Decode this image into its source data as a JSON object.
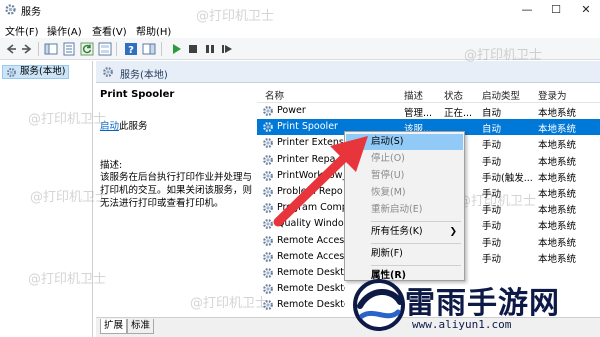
{
  "window": {
    "title": "服务"
  },
  "menu": [
    "文件(F)",
    "操作(A)",
    "查看(V)",
    "帮助(H)"
  ],
  "tree": {
    "node": "服务(本地)"
  },
  "header": {
    "title": "服务(本地)"
  },
  "description": {
    "service_name": "Print Spooler",
    "start_link": "启动",
    "start_suffix": "此服务",
    "desc_label": "描述:",
    "desc_text": "该服务在后台执行打印作业并处理与打印机的交互。如果关闭该服务，则无法进行打印或查看打印机。"
  },
  "columns": {
    "name": "名称",
    "desc": "描述",
    "status": "状态",
    "startup": "启动类型",
    "logon": "登录为"
  },
  "services": [
    {
      "name": "Power",
      "desc": "管理...",
      "status": "正在...",
      "startup": "自动",
      "logon": "本地系统"
    },
    {
      "name": "Print Spooler",
      "desc": "该服...",
      "status": "",
      "startup": "自动",
      "logon": "本地系统",
      "selected": true
    },
    {
      "name": "Printer Extensio",
      "desc": "",
      "status": "",
      "startup": "手动",
      "logon": "本地系统"
    },
    {
      "name": "Printer Repa",
      "desc": "",
      "status": "",
      "startup": "手动",
      "logon": "本地系统"
    },
    {
      "name": "PrintWorkflow_",
      "desc": "",
      "status": "",
      "startup": "手动(触发...",
      "logon": "本地系统"
    },
    {
      "name": "Problem Repo",
      "desc": "",
      "status": "",
      "startup": "手动",
      "logon": "本地系统"
    },
    {
      "name": "Program Comp",
      "desc": "",
      "status": "",
      "startup": "手动",
      "logon": "本地系统"
    },
    {
      "name": "Quality Window",
      "desc": "",
      "status": "",
      "startup": "手动",
      "logon": "本地系统"
    },
    {
      "name": "Remote Access",
      "desc": "",
      "status": "",
      "startup": "手动",
      "logon": "本地系统"
    },
    {
      "name": "Remote Access",
      "desc": "",
      "status": "",
      "startup": "手动",
      "logon": "本地系统"
    },
    {
      "name": "Remote Deskto",
      "desc": "",
      "status": "",
      "startup": "",
      "logon": ""
    },
    {
      "name": "Remote Deskto",
      "desc": "",
      "status": "",
      "startup": "",
      "logon": ""
    },
    {
      "name": "Remote Deskto",
      "desc": "",
      "status": "",
      "startup": "",
      "logon": ""
    }
  ],
  "context_menu": {
    "start": "启动(S)",
    "stop": "停止(O)",
    "pause": "暂停(U)",
    "resume": "恢复(M)",
    "restart": "重新启动(E)",
    "all_tasks": "所有任务(K)",
    "refresh": "刷新(F)",
    "properties": "属性(R)"
  },
  "tabs": {
    "extended": "扩展",
    "standard": "标准"
  },
  "watermark": "@打印机卫士",
  "logo": {
    "text": "雷雨手游网",
    "url": "www.aliyun1.com"
  },
  "colors": {
    "selection": "#0078d7",
    "menu_highlight": "#91c9f7",
    "arrow": "#e8343b",
    "logo": "#0d1a47"
  }
}
